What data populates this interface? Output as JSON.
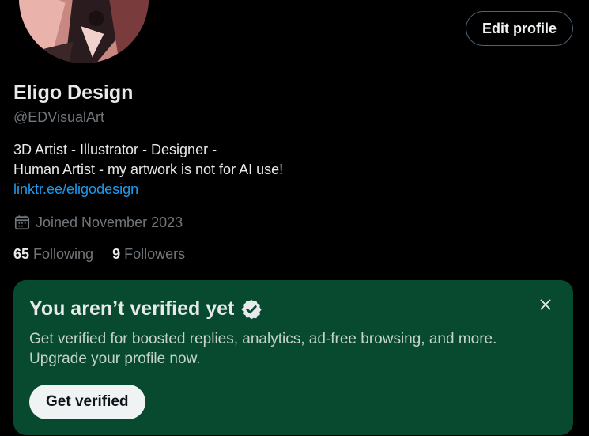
{
  "profile": {
    "edit_label": "Edit profile",
    "display_name": "Eligo Design",
    "handle": "@EDVisualArt",
    "bio_line1": "3D Artist - Illustrator - Designer -",
    "bio_line2": "Human Artist - my artwork is not for AI use!",
    "bio_link": "linktr.ee/eligodesign",
    "joined": "Joined November 2023",
    "calendar_icon": "calendar-icon"
  },
  "stats": {
    "following_count": "65",
    "following_label": "Following",
    "followers_count": "9",
    "followers_label": "Followers"
  },
  "verify": {
    "title": "You aren’t verified yet",
    "badge_icon": "verified-badge-icon",
    "description": "Get verified for boosted replies, analytics, ad-free browsing, and more. Upgrade your profile now.",
    "button_label": "Get verified",
    "close_icon": "close-icon"
  },
  "colors": {
    "background": "#000000",
    "link": "#1d9bf0",
    "muted": "#71767b",
    "card": "#074a2f"
  }
}
